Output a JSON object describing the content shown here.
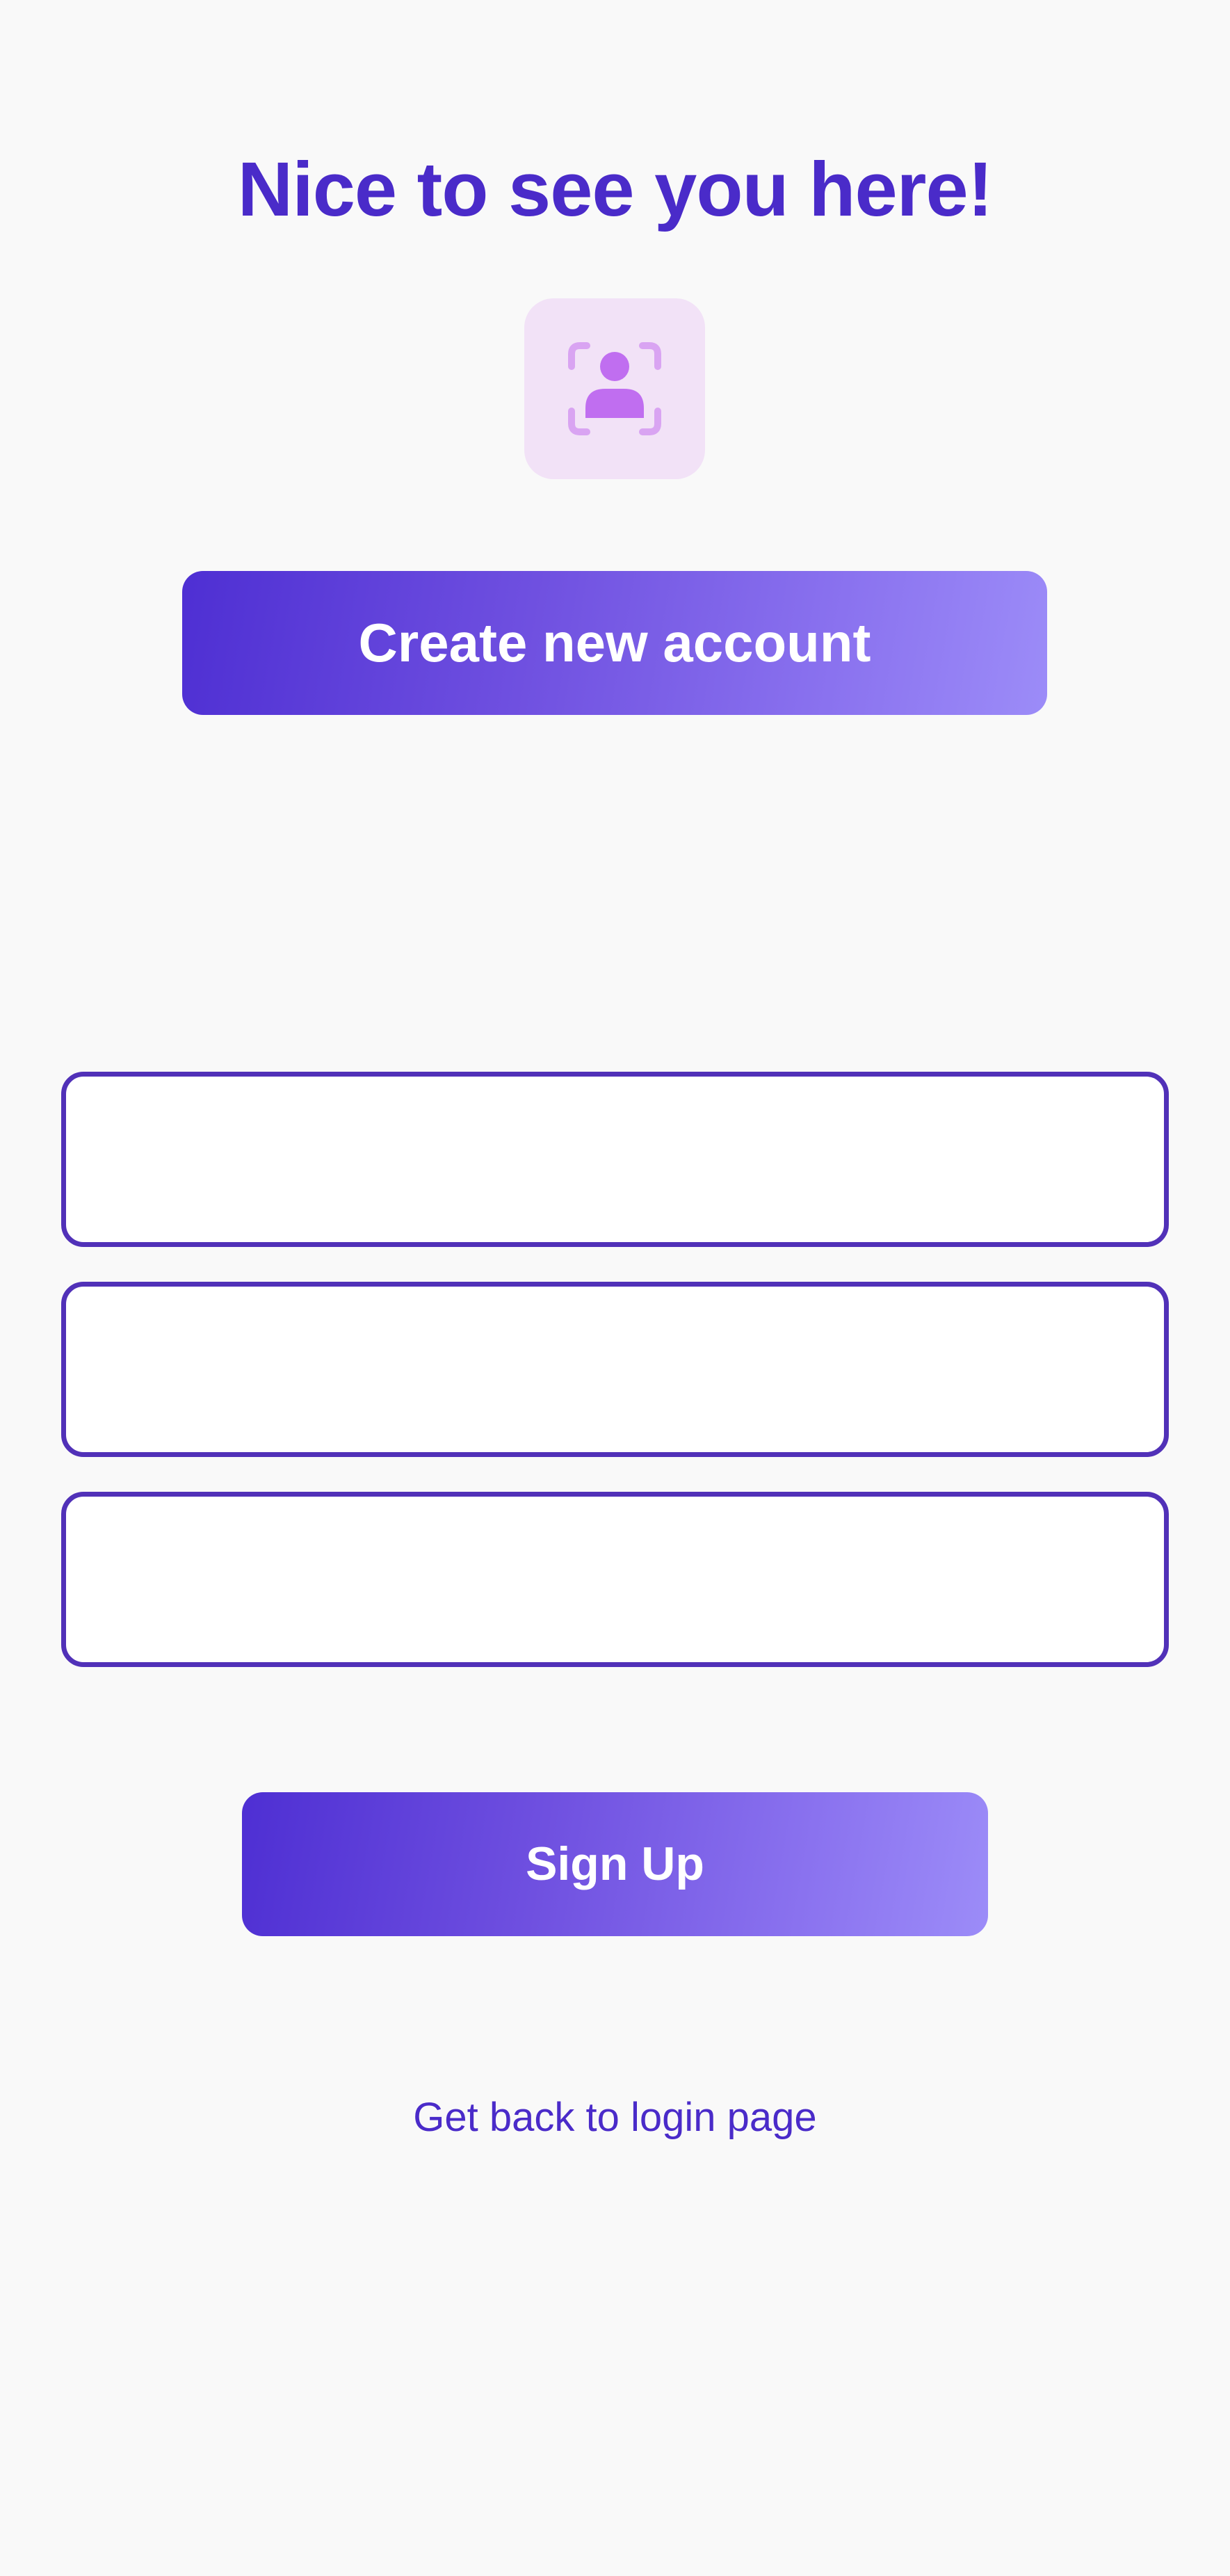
{
  "header": {
    "title": "Nice to see you here!"
  },
  "avatar": {
    "icon": "user-scan-icon",
    "tile_color": "#f2e2f7",
    "icon_color": "#c06ef0",
    "frame_color": "#d9a4f2"
  },
  "actions": {
    "create_account_label": "Create new account",
    "signup_label": "Sign Up",
    "back_to_login_label": "Get back to login page"
  },
  "form": {
    "fields": [
      {
        "value": "",
        "placeholder": ""
      },
      {
        "value": "",
        "placeholder": ""
      },
      {
        "value": "",
        "placeholder": ""
      }
    ]
  },
  "colors": {
    "accent": "#4a2bc9",
    "field_border": "#5131b8",
    "gradient_start": "#4e2fd3",
    "gradient_end": "#9c8cf8",
    "background": "#f9f9f9"
  }
}
